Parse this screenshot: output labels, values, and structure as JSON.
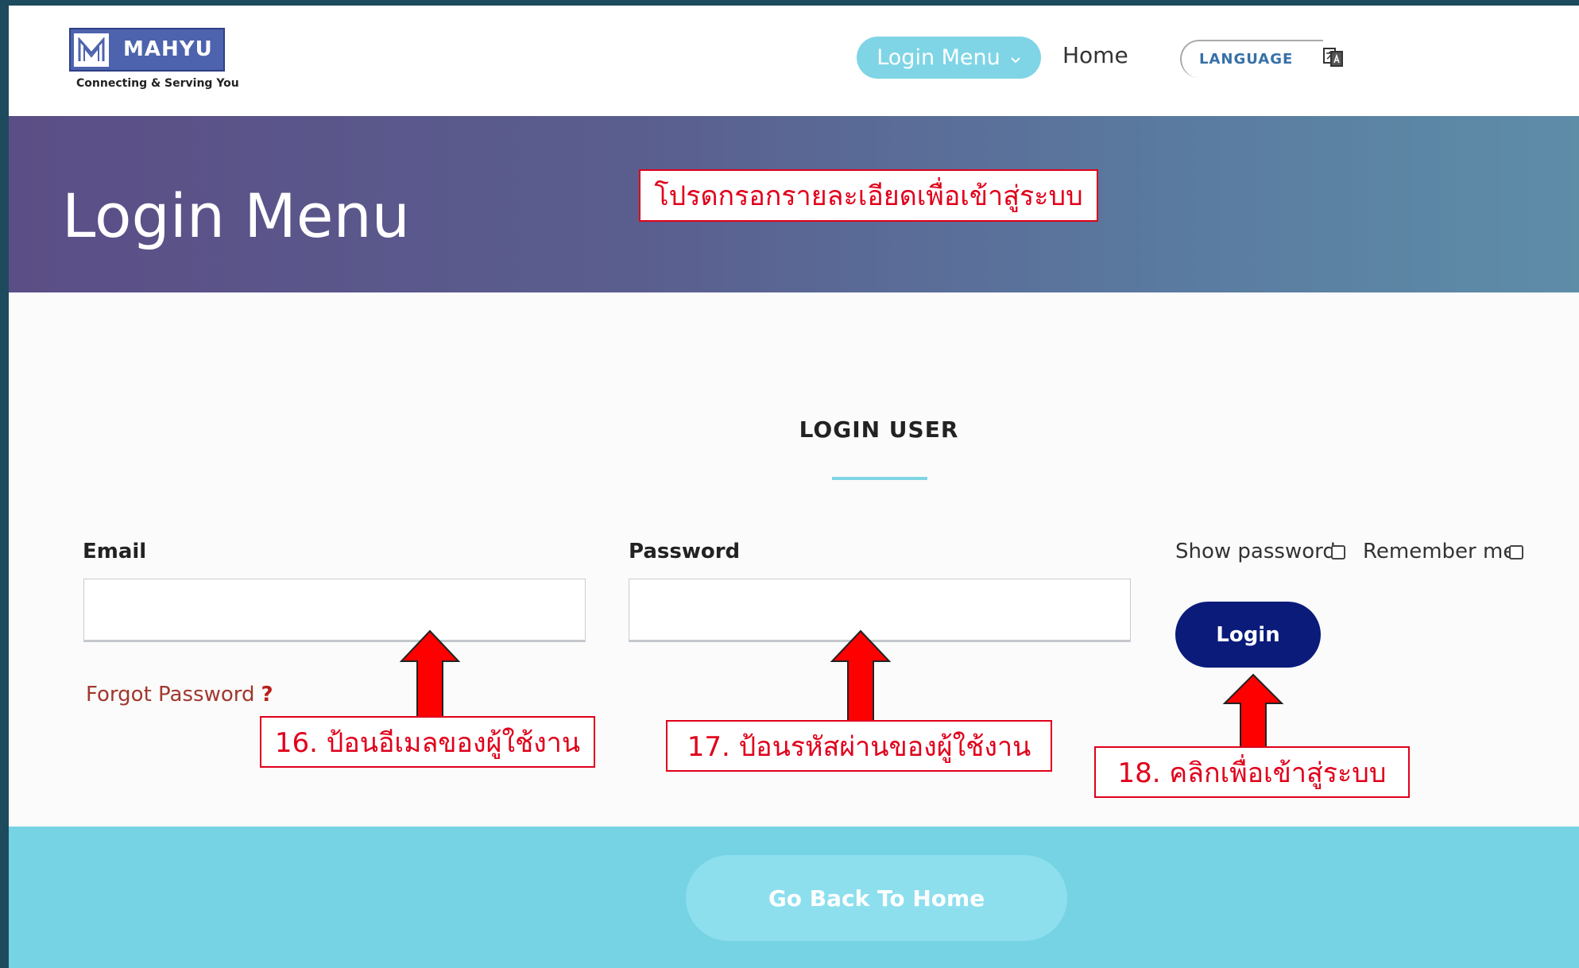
{
  "header": {
    "logo": {
      "name": "MAHYU",
      "tagline": "Connecting & Serving You"
    },
    "nav": {
      "login_menu": "Login Menu",
      "home": "Home",
      "language": "LANGUAGE"
    }
  },
  "banner": {
    "title": "Login Menu",
    "annotation": "โปรดกรอกรายละเอียดเพื่อเข้าสู่ระบบ"
  },
  "form": {
    "section_title": "LOGIN USER",
    "email_label": "Email",
    "email_value": "",
    "password_label": "Password",
    "password_value": "",
    "forgot_password": "Forgot Password",
    "forgot_mark": "?",
    "show_password": "Show password",
    "show_password_checked": false,
    "remember_me": "Remember me",
    "remember_me_checked": false,
    "login_button": "Login"
  },
  "annotations": {
    "step16": "16. ป้อนอีเมลของผู้ใช้งาน",
    "step17": "17. ป้อนรหัสผ่านของผู้ใช้งาน",
    "step18": "18. คลิกเพื่อเข้าสู่ระบบ",
    "color": "#e0001b"
  },
  "footer": {
    "back_button": "Go Back To Home"
  },
  "colors": {
    "accent": "#7fd5e6",
    "login_button": "#0a1b7a",
    "footer": "#75d3e3",
    "annotation_red": "#e0001b"
  }
}
